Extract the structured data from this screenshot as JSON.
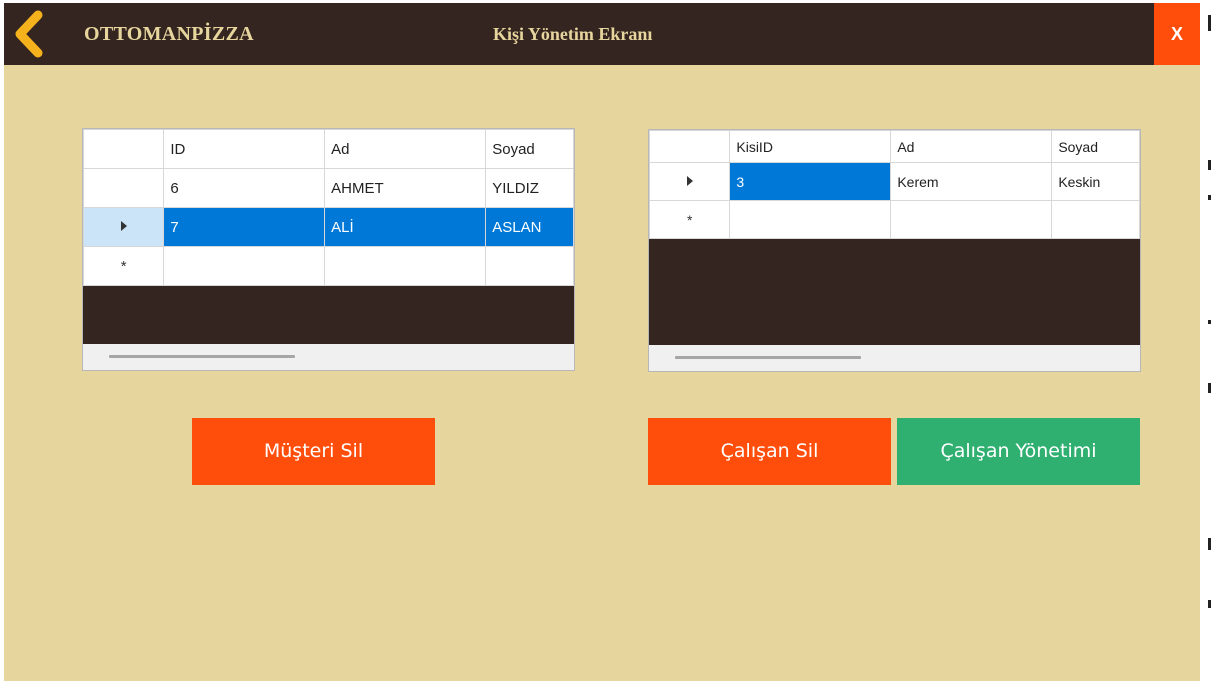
{
  "window": {
    "app_title": "OTTOMANPİZZA",
    "screen_title": "Kişi Yönetim Ekranı",
    "close_label": "X"
  },
  "customers_grid": {
    "columns": [
      "ID",
      "Ad",
      "Soyad"
    ],
    "rows": [
      [
        "6",
        "AHMET",
        "YILDIZ"
      ],
      [
        "7",
        "ALİ",
        "ASLAN"
      ]
    ],
    "selected_row": 1,
    "new_row_marker": "*"
  },
  "employees_grid": {
    "columns": [
      "KisiID",
      "Ad",
      "Soyad"
    ],
    "rows": [
      [
        "3",
        "Kerem",
        "Keskin"
      ]
    ],
    "selected_cell": "KisiID",
    "new_row_marker": "*"
  },
  "buttons": {
    "delete_customer": "Müşteri Sil",
    "delete_employee": "Çalışan Sil",
    "employee_management": "Çalışan Yönetimi"
  },
  "colors": {
    "background": "#e6d59d",
    "titlebar": "#352521",
    "accent_orange": "#ff4e0c",
    "accent_green": "#2faf70",
    "selection_blue": "#0078d7",
    "back_arrow": "#f5b21c"
  }
}
